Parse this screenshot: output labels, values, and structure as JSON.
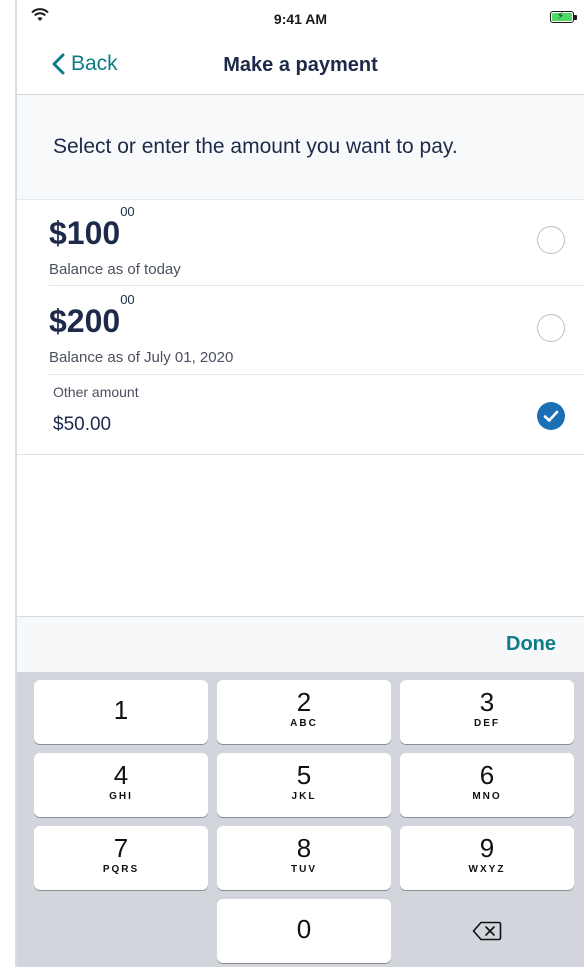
{
  "status_bar": {
    "time": "9:41 AM"
  },
  "nav": {
    "back_label": "Back",
    "title": "Make a payment"
  },
  "prompt": "Select or enter the amount you want to pay.",
  "options": [
    {
      "amount": "$100",
      "cents": "00",
      "description": "Balance as of today",
      "selected": false
    },
    {
      "amount": "$200",
      "cents": "00",
      "description": "Balance as of July 01, 2020",
      "selected": false
    }
  ],
  "other_amount": {
    "label": "Other amount",
    "value": "$50.00",
    "selected": true
  },
  "toolbar": {
    "done_label": "Done"
  },
  "keypad": {
    "keys": [
      {
        "num": "1",
        "letters": ""
      },
      {
        "num": "2",
        "letters": "ABC"
      },
      {
        "num": "3",
        "letters": "DEF"
      },
      {
        "num": "4",
        "letters": "GHI"
      },
      {
        "num": "5",
        "letters": "JKL"
      },
      {
        "num": "6",
        "letters": "MNO"
      },
      {
        "num": "7",
        "letters": "PQRS"
      },
      {
        "num": "8",
        "letters": "TUV"
      },
      {
        "num": "9",
        "letters": "WXYZ"
      },
      {
        "num": "0",
        "letters": ""
      }
    ]
  },
  "colors": {
    "accent": "#0e7c86",
    "selected": "#1a6fb5",
    "text_primary": "#1e2a4a"
  },
  "icons": {
    "back": "chevron-left-icon",
    "check": "checkmark-icon",
    "delete": "backspace-icon",
    "wifi": "wifi-icon",
    "battery": "battery-charging-icon"
  }
}
